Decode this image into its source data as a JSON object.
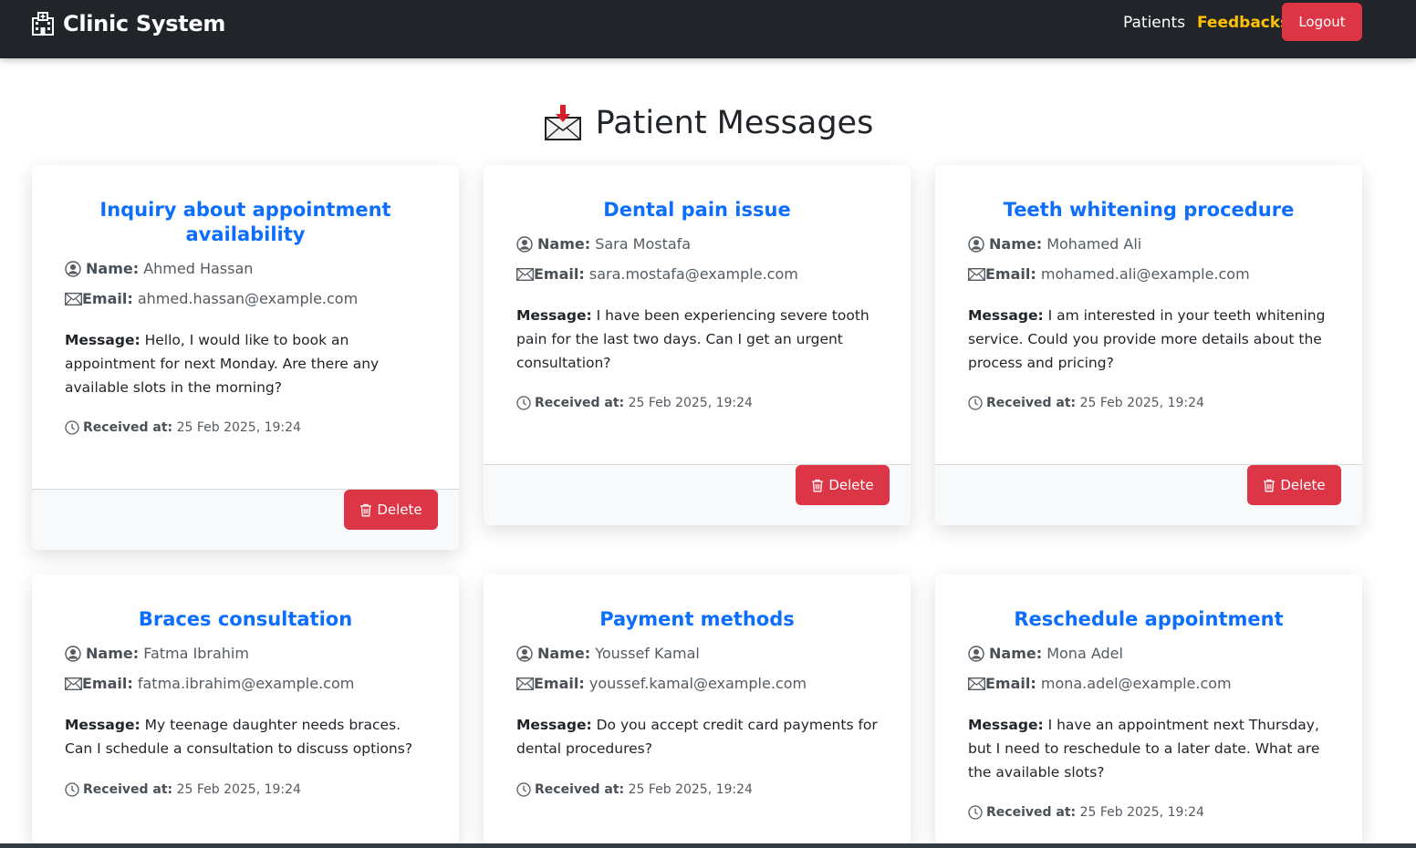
{
  "navbar": {
    "brand": "Clinic System",
    "brand_icon": "hospital-icon",
    "links": [
      {
        "label": "Patients",
        "active": false
      },
      {
        "label": "Feedbacks",
        "active": true
      }
    ],
    "logout_label": "Logout"
  },
  "page": {
    "title": "Patient Messages",
    "title_icon": "inbox-tray-icon"
  },
  "labels": {
    "name": "Name:",
    "email": "Email:",
    "message": "Message:",
    "received": "Received at:",
    "delete": "Delete"
  },
  "colors": {
    "navbar_bg": "#212529",
    "active_link": "#ffc107",
    "card_title": "#0d6efd",
    "danger": "#dc3545"
  },
  "messages": [
    {
      "subject": "Inquiry about appointment availability",
      "name": "Ahmed Hassan",
      "email": "ahmed.hassan@example.com",
      "message": "Hello, I would like to book an appointment for next Monday. Are there any available slots in the morning?",
      "received": "25 Feb 2025, 19:24"
    },
    {
      "subject": "Dental pain issue",
      "name": "Sara Mostafa",
      "email": "sara.mostafa@example.com",
      "message": "I have been experiencing severe tooth pain for the last two days. Can I get an urgent consultation?",
      "received": "25 Feb 2025, 19:24"
    },
    {
      "subject": "Teeth whitening procedure",
      "name": "Mohamed Ali",
      "email": "mohamed.ali@example.com",
      "message": "I am interested in your teeth whitening service. Could you provide more details about the process and pricing?",
      "received": "25 Feb 2025, 19:24"
    },
    {
      "subject": "Braces consultation",
      "name": "Fatma Ibrahim",
      "email": "fatma.ibrahim@example.com",
      "message": "My teenage daughter needs braces. Can I schedule a consultation to discuss options?",
      "received": "25 Feb 2025, 19:24"
    },
    {
      "subject": "Payment methods",
      "name": "Youssef Kamal",
      "email": "youssef.kamal@example.com",
      "message": "Do you accept credit card payments for dental procedures?",
      "received": "25 Feb 2025, 19:24"
    },
    {
      "subject": "Reschedule appointment",
      "name": "Mona Adel",
      "email": "mona.adel@example.com",
      "message": "I have an appointment next Thursday, but I need to reschedule to a later date. What are the available slots?",
      "received": "25 Feb 2025, 19:24"
    }
  ]
}
